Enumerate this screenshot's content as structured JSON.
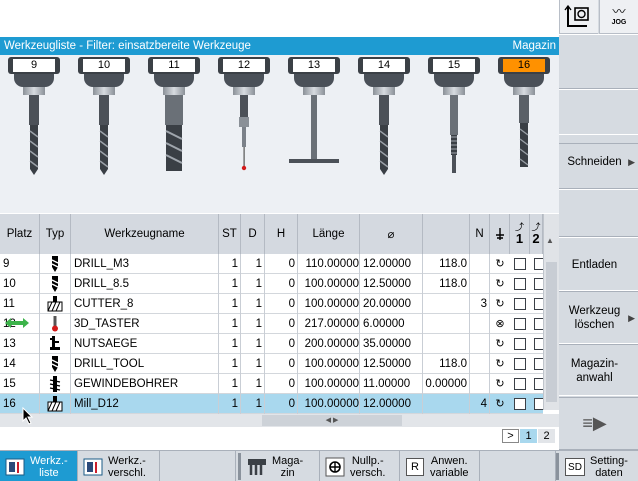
{
  "header": {
    "title": "Werkzeugliste - Filter: einsatzbereite Werkzeuge",
    "right_label": "Magazin",
    "jog_label": "JOG",
    "jog_icon": "jog-wave-icon"
  },
  "magazine": {
    "slots": [
      {
        "num": "9",
        "tool": "drill"
      },
      {
        "num": "10",
        "tool": "drill"
      },
      {
        "num": "11",
        "tool": "cutter"
      },
      {
        "num": "12",
        "tool": "probe"
      },
      {
        "num": "13",
        "tool": "slot-saw"
      },
      {
        "num": "14",
        "tool": "drill"
      },
      {
        "num": "15",
        "tool": "tap"
      },
      {
        "num": "16",
        "tool": "mill",
        "active": true
      }
    ]
  },
  "table": {
    "headers": {
      "platz": "Platz",
      "typ": "Typ",
      "name": "Werkzeugname",
      "st": "ST",
      "d": "D",
      "h": "H",
      "laenge": "Länge",
      "dia": "⌀",
      "n": "N",
      "col1": "1",
      "col2": "2"
    },
    "rows": [
      {
        "platz": "9",
        "typ": "drill",
        "name": "DRILL_M3",
        "st": "1",
        "d": "1",
        "h": "0",
        "laenge": "110.00000",
        "dia": "12.00000",
        "angle": "118.0",
        "n": "",
        "spindle": "cw"
      },
      {
        "platz": "10",
        "typ": "drill",
        "name": "DRILL_8.5",
        "st": "1",
        "d": "1",
        "h": "0",
        "laenge": "100.00000",
        "dia": "12.50000",
        "angle": "118.0",
        "n": "",
        "spindle": "cw"
      },
      {
        "platz": "11",
        "typ": "cutter",
        "name": "CUTTER_8",
        "st": "1",
        "d": "1",
        "h": "0",
        "laenge": "100.00000",
        "dia": "20.00000",
        "angle": "",
        "n": "3",
        "spindle": "cw"
      },
      {
        "platz": "12",
        "typ": "probe",
        "name": "3D_TASTER",
        "st": "1",
        "d": "1",
        "h": "0",
        "laenge": "217.00000",
        "dia": "6.00000",
        "angle": "",
        "n": "",
        "spindle": "off"
      },
      {
        "platz": "13",
        "typ": "saw",
        "name": "NUTSAEGE",
        "st": "1",
        "d": "1",
        "h": "0",
        "laenge": "200.00000",
        "dia": "35.00000",
        "angle": "",
        "n": "",
        "spindle": "cw"
      },
      {
        "platz": "14",
        "typ": "drill",
        "name": "DRILL_TOOL",
        "st": "1",
        "d": "1",
        "h": "0",
        "laenge": "100.00000",
        "dia": "12.50000",
        "angle": "118.0",
        "n": "",
        "spindle": "cw"
      },
      {
        "platz": "15",
        "typ": "tap",
        "name": "GEWINDEBOHRER",
        "st": "1",
        "d": "1",
        "h": "0",
        "laenge": "100.00000",
        "dia": "11.00000",
        "angle": "0.00000",
        "n": "",
        "spindle": "cw"
      },
      {
        "platz": "16",
        "typ": "cutter",
        "name": "Mill_D12",
        "st": "1",
        "d": "1",
        "h": "0",
        "laenge": "100.00000",
        "dia": "12.00000",
        "angle": "",
        "n": "4",
        "spindle": "cw",
        "selected": true
      }
    ],
    "pager": {
      "current": "1",
      "next": "2",
      "arrow": ">"
    }
  },
  "vertical_softkeys": {
    "schneiden": "Schneiden",
    "entladen": "Entladen",
    "werkzeug_loeschen": "Werkzeug\nlöschen",
    "magazinanwahl": "Magazin-\nanwahl"
  },
  "bottom_softkeys": {
    "werkz_liste": "Werkz.-\nliste",
    "werkz_verschl": "Werkz.-\nverschl.",
    "magazin": "Maga-\nzin",
    "nullp_versch": "Nullp.-\nversch.",
    "anwen_variable": "Anwen.\nvariable",
    "settingdaten": "Setting-\ndaten",
    "sd_icon_label": "SD",
    "r_icon_label": "R"
  },
  "colors": {
    "accent": "#1e9bd2",
    "active_slot": "#ff9100",
    "selected_row": "#a9d8ee",
    "softkey_bg": "#d6dbe1"
  }
}
